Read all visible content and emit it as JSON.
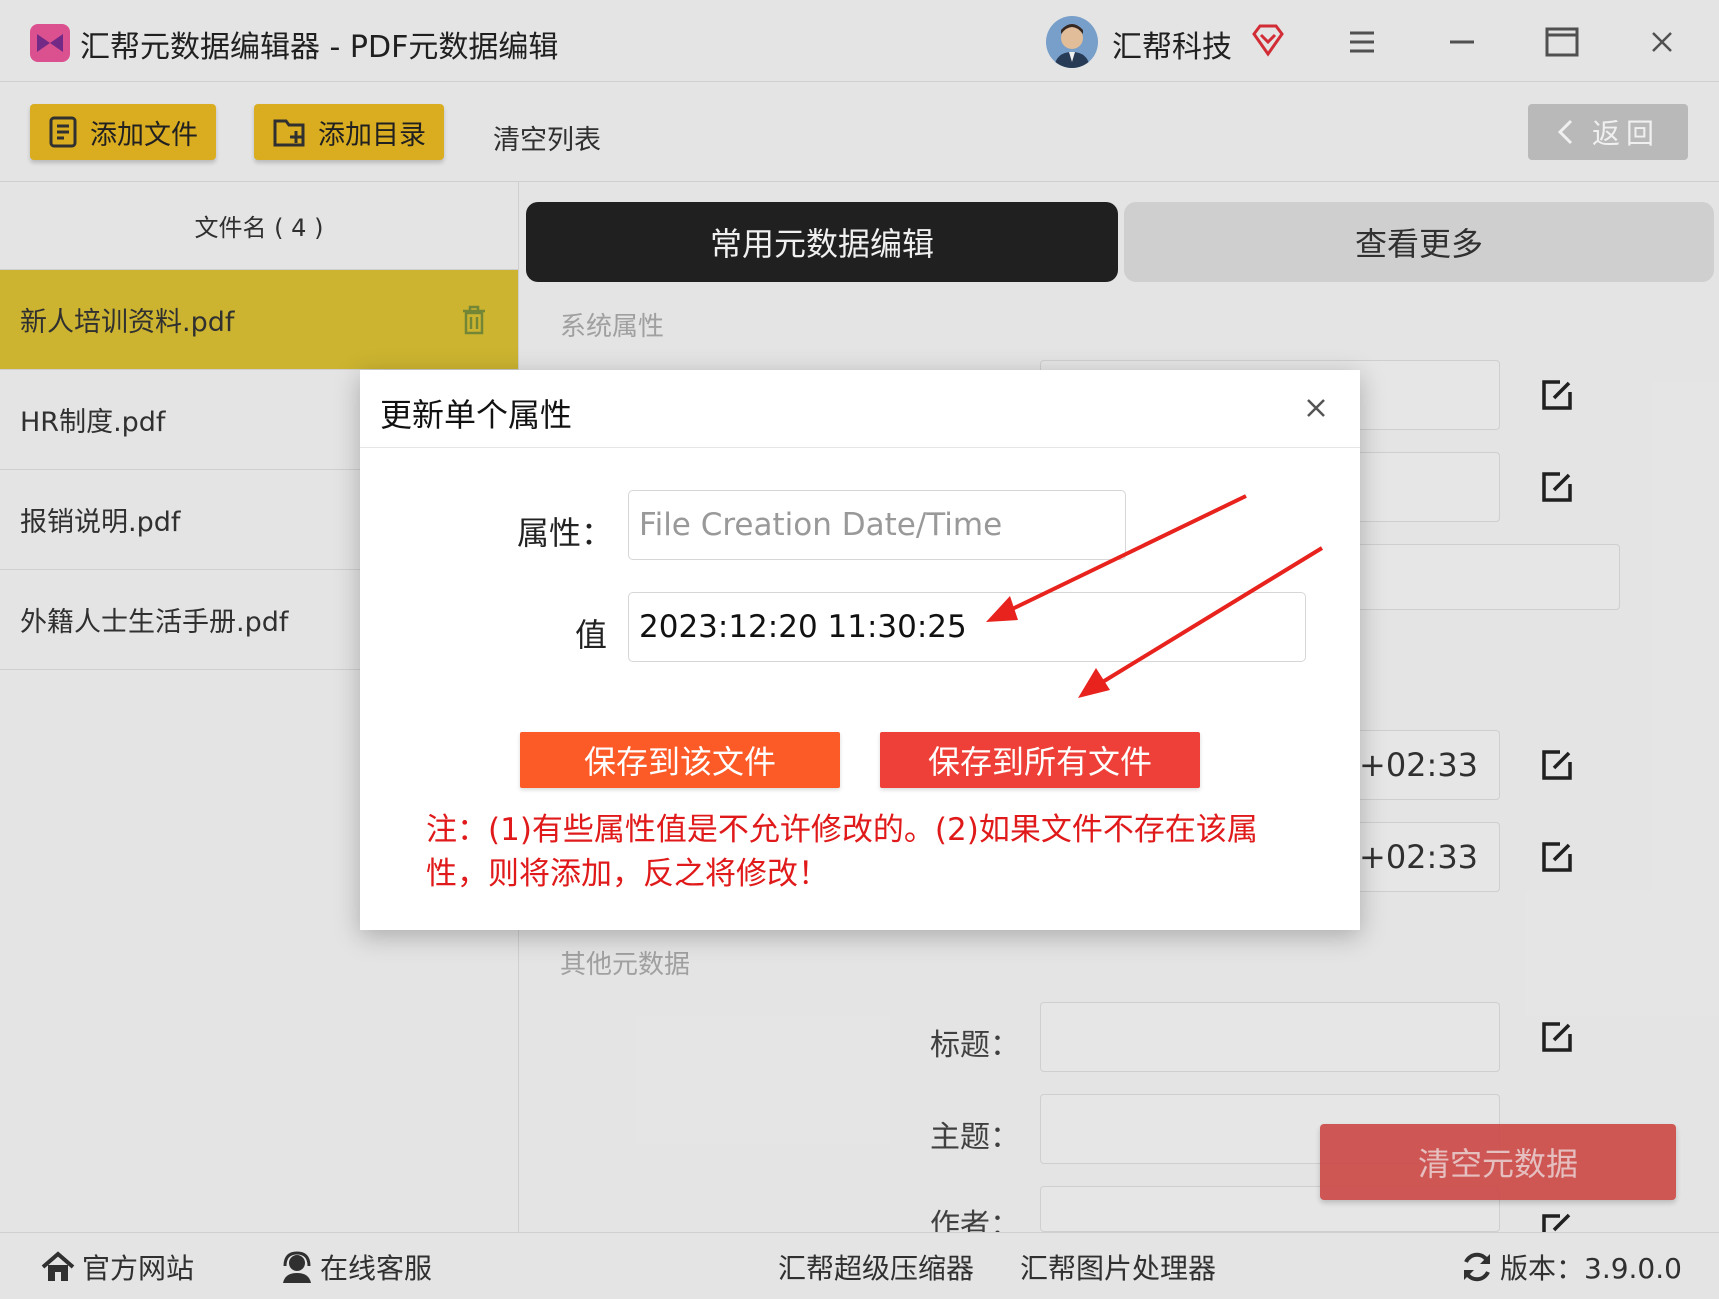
{
  "window": {
    "title": "汇帮元数据编辑器 - PDF元数据编辑",
    "brand": "汇帮科技",
    "controls": [
      "menu-icon",
      "minimize-icon",
      "maximize-icon",
      "close-icon"
    ]
  },
  "toolbar": {
    "add_file": "添加文件",
    "add_folder": "添加目录",
    "clear_list": "清空列表",
    "back": "返回"
  },
  "filelist": {
    "header": "文件名 ( 4 )",
    "files": [
      "新人培训资料.pdf",
      "HR制度.pdf",
      "报销说明.pdf",
      "外籍人士生活手册.pdf"
    ]
  },
  "panel": {
    "tabs": [
      "常用元数据编辑",
      "查看更多"
    ],
    "system_section": "系统属性",
    "date_value_1": "+02:33",
    "date_value_2": "+02:33",
    "other_section": "其他元数据",
    "labels": {
      "title": "标题：",
      "subject": "主题：",
      "author": "作者："
    },
    "clear_metadata": "清空元数据"
  },
  "dialog": {
    "title": "更新单个属性",
    "property_label": "属性：",
    "property_placeholder": "File Creation Date/Time",
    "value_label": "值",
    "value": "2023:12:20 11:30:25",
    "save_this": "保存到该文件",
    "save_all": "保存到所有文件",
    "note": "注：(1)有些属性值是不允许修改的。(2)如果文件不存在该属性，则将添加，反之将修改！"
  },
  "footer": {
    "website": "官方网站",
    "support": "在线客服",
    "compressor": "汇帮超级压缩器",
    "image_tool": "汇帮图片处理器",
    "version": "版本：3.9.0.0"
  },
  "colors": {
    "toolbar_button": "#e8b823",
    "active_file": "#d9c034",
    "save_this": "#fc5a27",
    "save_all": "#ee4038",
    "note_text": "#e01a1a",
    "clear_metadata": "#d9514e"
  }
}
